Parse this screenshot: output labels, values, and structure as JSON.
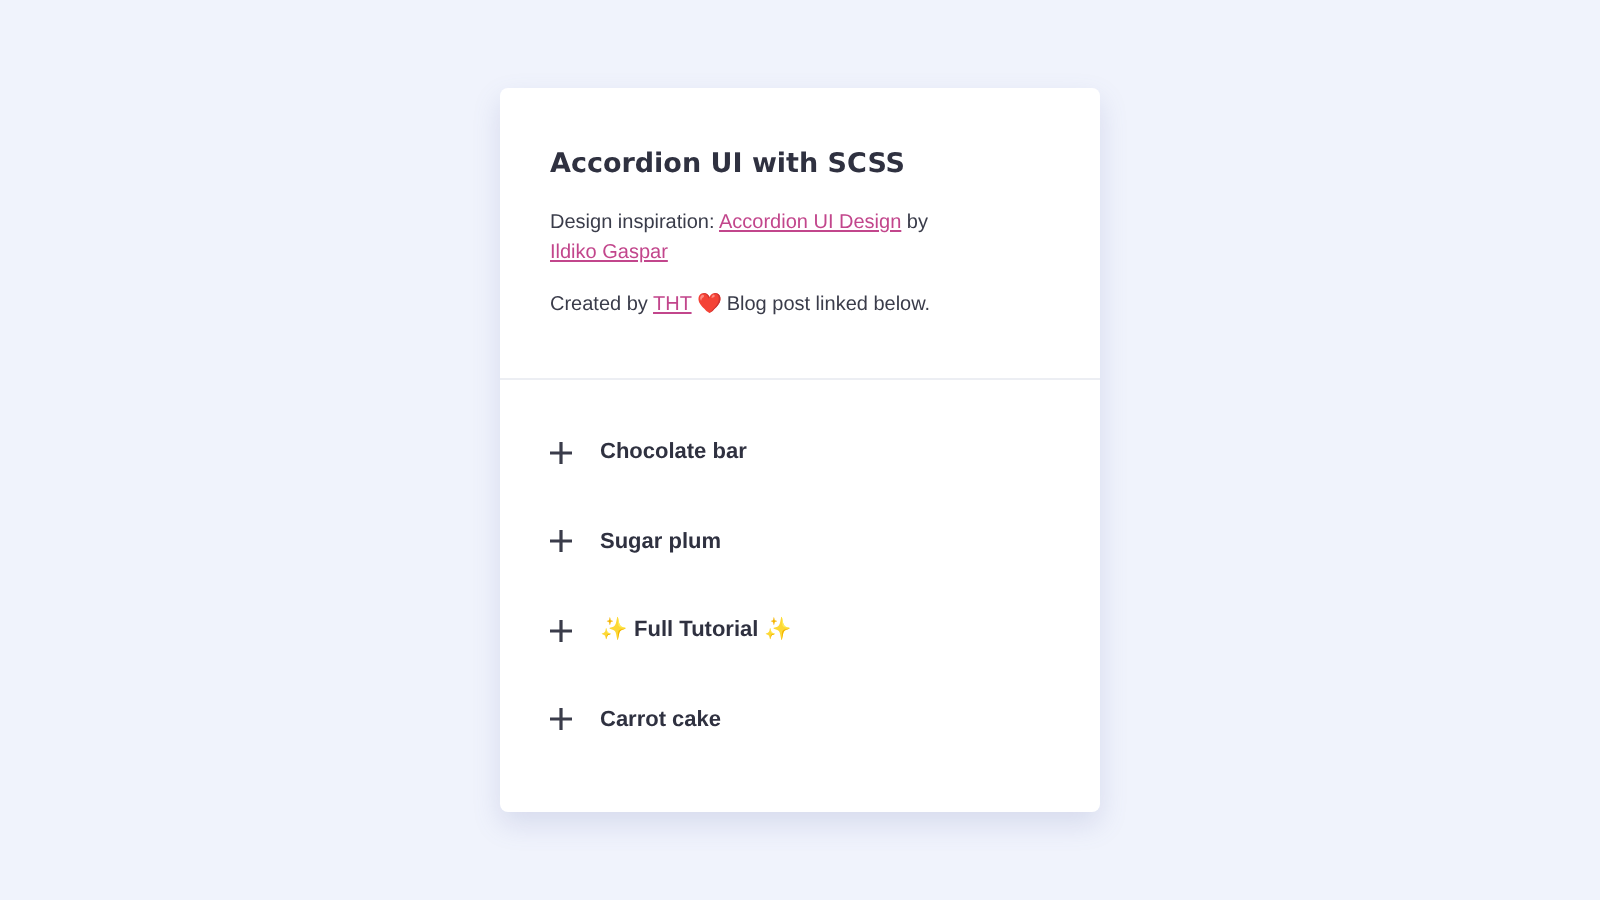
{
  "title": "Accordion UI with SCSS",
  "intro": [
    [
      {
        "kind": "text",
        "text": "Design inspiration: "
      },
      {
        "kind": "link",
        "text": "Accordion UI Design"
      },
      {
        "kind": "text",
        "text": " by "
      },
      {
        "kind": "link",
        "text": "Ildiko Gaspar"
      }
    ],
    [
      {
        "kind": "text",
        "text": "Created by "
      },
      {
        "kind": "link",
        "text": "THT"
      },
      {
        "kind": "text",
        "text": " ❤️ Blog post linked below."
      }
    ]
  ],
  "accordion": [
    {
      "label": "Chocolate bar",
      "expanded": false
    },
    {
      "label": "Sugar plum",
      "expanded": false
    },
    {
      "label": "✨ Full Tutorial ✨",
      "expanded": false
    },
    {
      "label": "Carrot cake",
      "expanded": false
    }
  ]
}
